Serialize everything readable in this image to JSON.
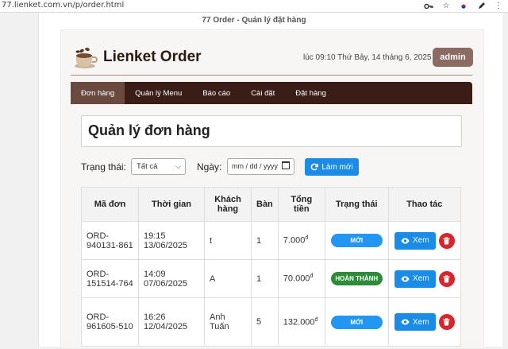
{
  "browser": {
    "url": "77.lienket.com.vn/p/order.html"
  },
  "document_title": "77 Order - Quản lý đặt hàng",
  "header": {
    "brand": "Lienket Order",
    "clock": "lúc 09:10 Thứ Bảy, 14 tháng 6, 2025",
    "user_button": "admin"
  },
  "nav": [
    {
      "label": "Đơn hàng",
      "active": true
    },
    {
      "label": "Quản lý Menu",
      "active": false
    },
    {
      "label": "Báo cáo",
      "active": false
    },
    {
      "label": "Cài đặt",
      "active": false
    },
    {
      "label": "Đặt hàng",
      "active": false
    }
  ],
  "page_title": "Quản lý đơn hàng",
  "filters": {
    "status_label": "Trạng thái:",
    "status_value": "Tất cả",
    "date_label": "Ngày:",
    "date_placeholder": "mm / dd / yyyy",
    "refresh_label": "Làm mới"
  },
  "table": {
    "headers": [
      "Mã đơn",
      "Thời gian",
      "Khách hàng",
      "Bàn",
      "Tổng tiền",
      "Trạng thái",
      "Thao tác"
    ],
    "view_label": "Xem",
    "currency": "đ",
    "rows": [
      {
        "id": "ORD-940131-861",
        "time": "19:15 13/06/2025",
        "customer": "t",
        "table": "1",
        "total": "7.000",
        "status": "MỚI",
        "status_color": "#2196f3"
      },
      {
        "id": "ORD-151514-764",
        "time": "14:09 07/06/2025",
        "customer": "A",
        "table": "1",
        "total": "70.000",
        "status": "HOÀN THÀNH",
        "status_color": "#2e8b3a"
      },
      {
        "id": "ORD-961605-510",
        "time": "16:26 12/04/2025",
        "customer": "Anh Tuấn",
        "table": "5",
        "total": "132.000",
        "status": "MỚI",
        "status_color": "#2196f3"
      }
    ]
  },
  "icons": [
    "key-icon",
    "star-icon",
    "flag-icon",
    "pen-icon",
    "menu-dots-icon",
    "logo-coffee-icon",
    "refresh-icon",
    "eye-icon",
    "trash-icon",
    "calendar-icon",
    "chevron-down-icon"
  ],
  "colors": {
    "nav_bg": "#3a1d16",
    "nav_active": "#6a4a3f",
    "admin_bg": "#8b6b62",
    "primary": "#1a8ce8",
    "danger": "#d9262c",
    "status_new": "#2196f3",
    "status_done": "#2e8b3a"
  }
}
